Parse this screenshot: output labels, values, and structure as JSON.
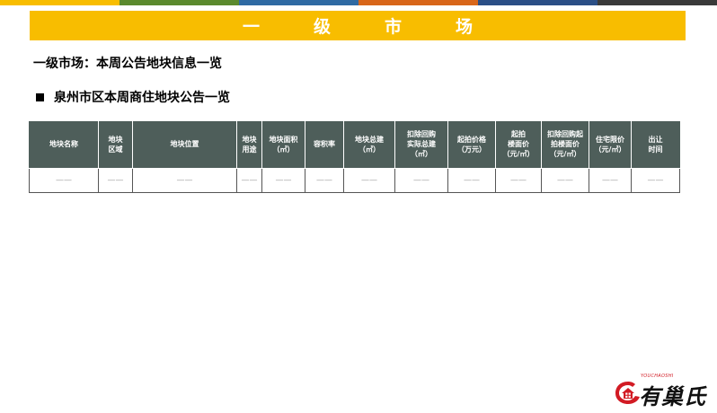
{
  "banner": {
    "title": "一级市场"
  },
  "subtitle": "一级市场：本周公告地块信息一览",
  "section_heading": "泉州市区本周商住地块公告一览",
  "table": {
    "headers": [
      "地块名称",
      "地块\n区域",
      "地块位置",
      "地块\n用途",
      "地块面积\n（㎡）",
      "容积率",
      "地块总建\n（㎡）",
      "扣除回购\n实际总建\n（㎡）",
      "起拍价格\n（万元）",
      "起拍\n楼面价\n（元/㎡）",
      "扣除回购起\n拍楼面价\n（元/㎡）",
      "住宅限价\n（元/㎡）",
      "出让\n时间"
    ],
    "rows": [
      [
        "——",
        "——",
        "——",
        "——",
        "——",
        "——",
        "——",
        "——",
        "——",
        "——",
        "——",
        "——",
        "——"
      ]
    ]
  },
  "logo": {
    "small_text": "YOUCHAOSHI",
    "brand_text": "有巢氏"
  },
  "colors": {
    "banner": "#f8bd00",
    "table_header": "#4e5e5a",
    "brand_red": "#d21b24",
    "stripes": [
      "#f8bd00",
      "#5b8a2e",
      "#2f6aa3",
      "#d8661a",
      "#2b4f86",
      "#3a3a3a"
    ]
  }
}
